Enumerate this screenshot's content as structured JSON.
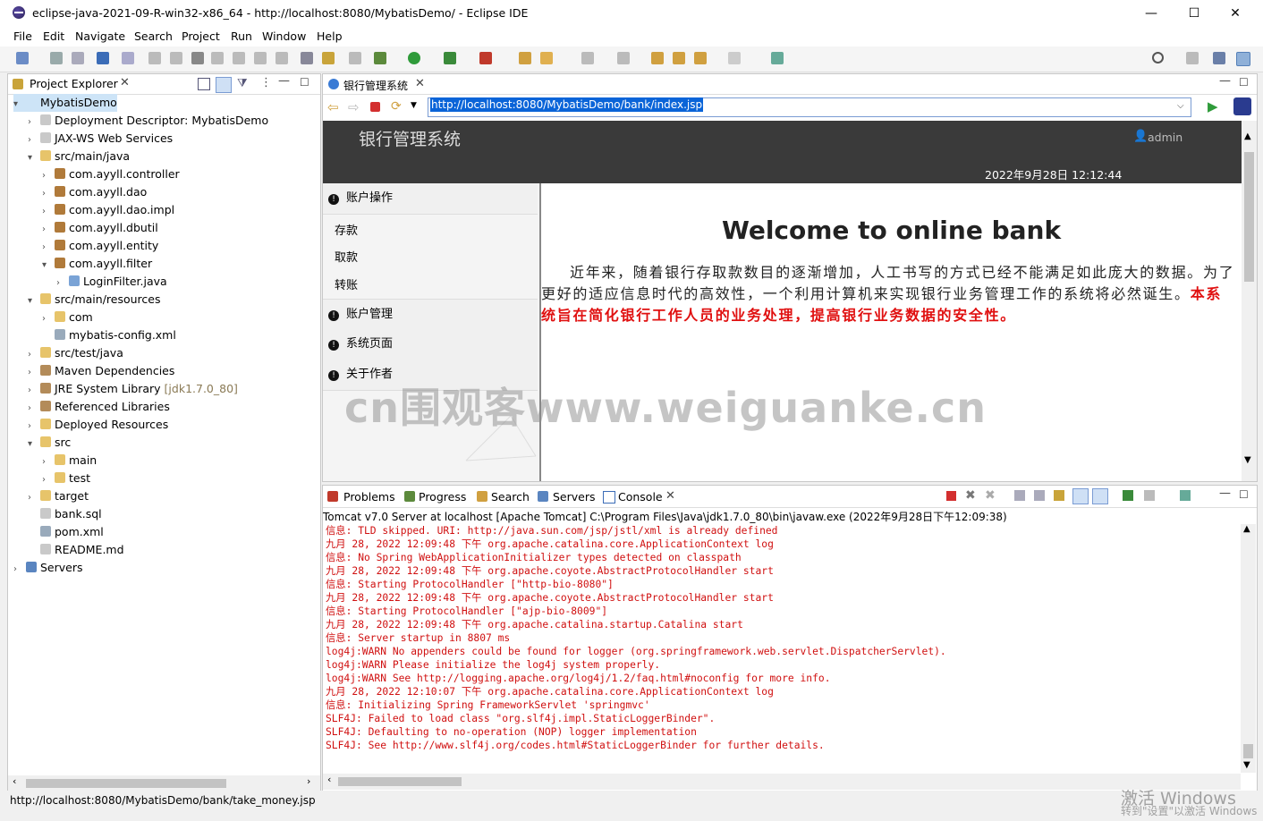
{
  "window": {
    "title": "eclipse-java-2021-09-R-win32-x86_64 - http://localhost:8080/MybatisDemo/ - Eclipse IDE",
    "minimize": "—",
    "maximize": "☐",
    "close": "✕"
  },
  "menu": [
    "File",
    "Edit",
    "Navigate",
    "Search",
    "Project",
    "Run",
    "Window",
    "Help"
  ],
  "project_explorer": {
    "tab_label": "Project Explorer",
    "items": [
      {
        "label": "MybatisDemo",
        "depth": 0,
        "arrow": "▾",
        "icon": "project"
      },
      {
        "label": "Deployment Descriptor: MybatisDemo",
        "depth": 1,
        "arrow": "›",
        "icon": "file"
      },
      {
        "label": "JAX-WS Web Services",
        "depth": 1,
        "arrow": "›",
        "icon": "file"
      },
      {
        "label": "src/main/java",
        "depth": 1,
        "arrow": "▾",
        "icon": "folder"
      },
      {
        "label": "com.ayyll.controller",
        "depth": 2,
        "arrow": "›",
        "icon": "pkg"
      },
      {
        "label": "com.ayyll.dao",
        "depth": 2,
        "arrow": "›",
        "icon": "pkg"
      },
      {
        "label": "com.ayyll.dao.impl",
        "depth": 2,
        "arrow": "›",
        "icon": "pkg"
      },
      {
        "label": "com.ayyll.dbutil",
        "depth": 2,
        "arrow": "›",
        "icon": "pkg"
      },
      {
        "label": "com.ayyll.entity",
        "depth": 2,
        "arrow": "›",
        "icon": "pkg"
      },
      {
        "label": "com.ayyll.filter",
        "depth": 2,
        "arrow": "▾",
        "icon": "pkg"
      },
      {
        "label": "LoginFilter.java",
        "depth": 3,
        "arrow": "›",
        "icon": "java"
      },
      {
        "label": "src/main/resources",
        "depth": 1,
        "arrow": "▾",
        "icon": "folder"
      },
      {
        "label": "com",
        "depth": 2,
        "arrow": "›",
        "icon": "folder"
      },
      {
        "label": "mybatis-config.xml",
        "depth": 2,
        "arrow": "",
        "icon": "xml"
      },
      {
        "label": "src/test/java",
        "depth": 1,
        "arrow": "›",
        "icon": "folder"
      },
      {
        "label": "Maven Dependencies",
        "depth": 1,
        "arrow": "›",
        "icon": "lib"
      },
      {
        "label": "JRE System Library",
        "depth": 1,
        "arrow": "›",
        "icon": "lib",
        "suffix": "[jdk1.7.0_80]"
      },
      {
        "label": "Referenced Libraries",
        "depth": 1,
        "arrow": "›",
        "icon": "lib"
      },
      {
        "label": "Deployed Resources",
        "depth": 1,
        "arrow": "›",
        "icon": "folder"
      },
      {
        "label": "src",
        "depth": 1,
        "arrow": "▾",
        "icon": "folder"
      },
      {
        "label": "main",
        "depth": 2,
        "arrow": "›",
        "icon": "folder"
      },
      {
        "label": "test",
        "depth": 2,
        "arrow": "›",
        "icon": "folder"
      },
      {
        "label": "target",
        "depth": 1,
        "arrow": "›",
        "icon": "folder"
      },
      {
        "label": "bank.sql",
        "depth": 1,
        "arrow": "",
        "icon": "file"
      },
      {
        "label": "pom.xml",
        "depth": 1,
        "arrow": "",
        "icon": "xml"
      },
      {
        "label": "README.md",
        "depth": 1,
        "arrow": "",
        "icon": "file"
      },
      {
        "label": "Servers",
        "depth": 0,
        "arrow": "›",
        "icon": "server"
      }
    ]
  },
  "browser": {
    "tab_label": "银行管理系统",
    "url": "http://localhost:8080/MybatisDemo/bank/index.jsp",
    "page": {
      "header_title": "银行管理系统",
      "user": "admin",
      "datetime": "2022年9月28日 12:12:44",
      "sidebar": {
        "group1": "账户操作",
        "sub": [
          "存款",
          "取款",
          "转账"
        ],
        "group2": "账户管理",
        "group3": "系统页面",
        "group4": "关于作者"
      },
      "welcome": "Welcome to online bank",
      "intro_normal": "近年来，随着银行存取款数目的逐渐增加，人工书写的方式已经不能满足如此庞大的数据。为了更好的适应信息时代的高效性，一个利用计算机来实现银行业务管理工作的系统将必然诞生。",
      "intro_red": "本系统旨在简化银行工作人员的业务处理，提高银行业务数据的安全性。"
    }
  },
  "console": {
    "tabs": [
      "Problems",
      "Progress",
      "Search",
      "Servers",
      "Console"
    ],
    "header": "Tomcat v7.0 Server at localhost [Apache Tomcat] C:\\Program Files\\Java\\jdk1.7.0_80\\bin\\javaw.exe  (2022年9月28日下午12:09:38)",
    "lines": [
      "信息: TLD skipped. URI: http://java.sun.com/jsp/jstl/xml is already defined",
      "九月 28, 2022 12:09:48 下午 org.apache.catalina.core.ApplicationContext log",
      "信息: No Spring WebApplicationInitializer types detected on classpath",
      "九月 28, 2022 12:09:48 下午 org.apache.coyote.AbstractProtocolHandler start",
      "信息: Starting ProtocolHandler [\"http-bio-8080\"]",
      "九月 28, 2022 12:09:48 下午 org.apache.coyote.AbstractProtocolHandler start",
      "信息: Starting ProtocolHandler [\"ajp-bio-8009\"]",
      "九月 28, 2022 12:09:48 下午 org.apache.catalina.startup.Catalina start",
      "信息: Server startup in 8807 ms",
      "log4j:WARN No appenders could be found for logger (org.springframework.web.servlet.DispatcherServlet).",
      "log4j:WARN Please initialize the log4j system properly.",
      "log4j:WARN See http://logging.apache.org/log4j/1.2/faq.html#noconfig for more info.",
      "九月 28, 2022 12:10:07 下午 org.apache.catalina.core.ApplicationContext log",
      "信息: Initializing Spring FrameworkServlet 'springmvc'",
      "SLF4J: Failed to load class \"org.slf4j.impl.StaticLoggerBinder\".",
      "SLF4J: Defaulting to no-operation (NOP) logger implementation",
      "SLF4J: See http://www.slf4j.org/codes.html#StaticLoggerBinder for further details."
    ]
  },
  "status_bar": {
    "text": "http://localhost:8080/MybatisDemo/bank/take_money.jsp",
    "activation_line1": "激活 Windows",
    "activation_line2": "转到\"设置\"以激活 Windows。"
  },
  "watermark": "cn围观客www.weiguanke.cn"
}
